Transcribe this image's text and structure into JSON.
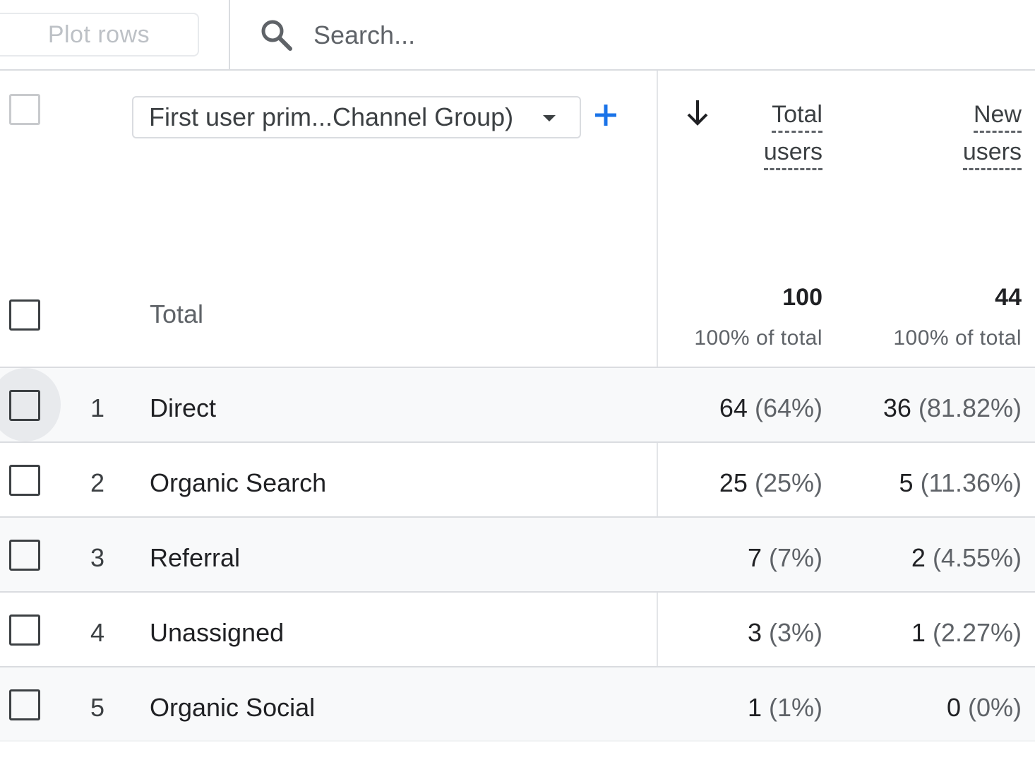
{
  "toolbar": {
    "plot_rows_label": "Plot rows",
    "search_placeholder": "Search..."
  },
  "header": {
    "dimension_label": "First user prim...Channel Group)",
    "metrics": [
      {
        "line1": "Total",
        "line2": "users"
      },
      {
        "line1": "New",
        "line2": "users"
      }
    ],
    "sort_icon": "arrow-down-icon",
    "add_icon": "plus-icon",
    "accent_color": "#1a73e8"
  },
  "total": {
    "label": "Total",
    "values": [
      "100",
      "44"
    ],
    "subtitles": [
      "100% of total",
      "100% of total"
    ]
  },
  "rows": [
    {
      "index": "1",
      "dimension": "Direct",
      "total_users": "64",
      "total_users_pct": "(64%)",
      "new_users": "36",
      "new_users_pct": "(81.82%)"
    },
    {
      "index": "2",
      "dimension": "Organic Search",
      "total_users": "25",
      "total_users_pct": "(25%)",
      "new_users": "5",
      "new_users_pct": "(11.36%)"
    },
    {
      "index": "3",
      "dimension": "Referral",
      "total_users": "7",
      "total_users_pct": "(7%)",
      "new_users": "2",
      "new_users_pct": "(4.55%)"
    },
    {
      "index": "4",
      "dimension": "Unassigned",
      "total_users": "3",
      "total_users_pct": "(3%)",
      "new_users": "1",
      "new_users_pct": "(2.27%)"
    },
    {
      "index": "5",
      "dimension": "Organic Social",
      "total_users": "1",
      "total_users_pct": "(1%)",
      "new_users": "0",
      "new_users_pct": "(0%)"
    }
  ]
}
